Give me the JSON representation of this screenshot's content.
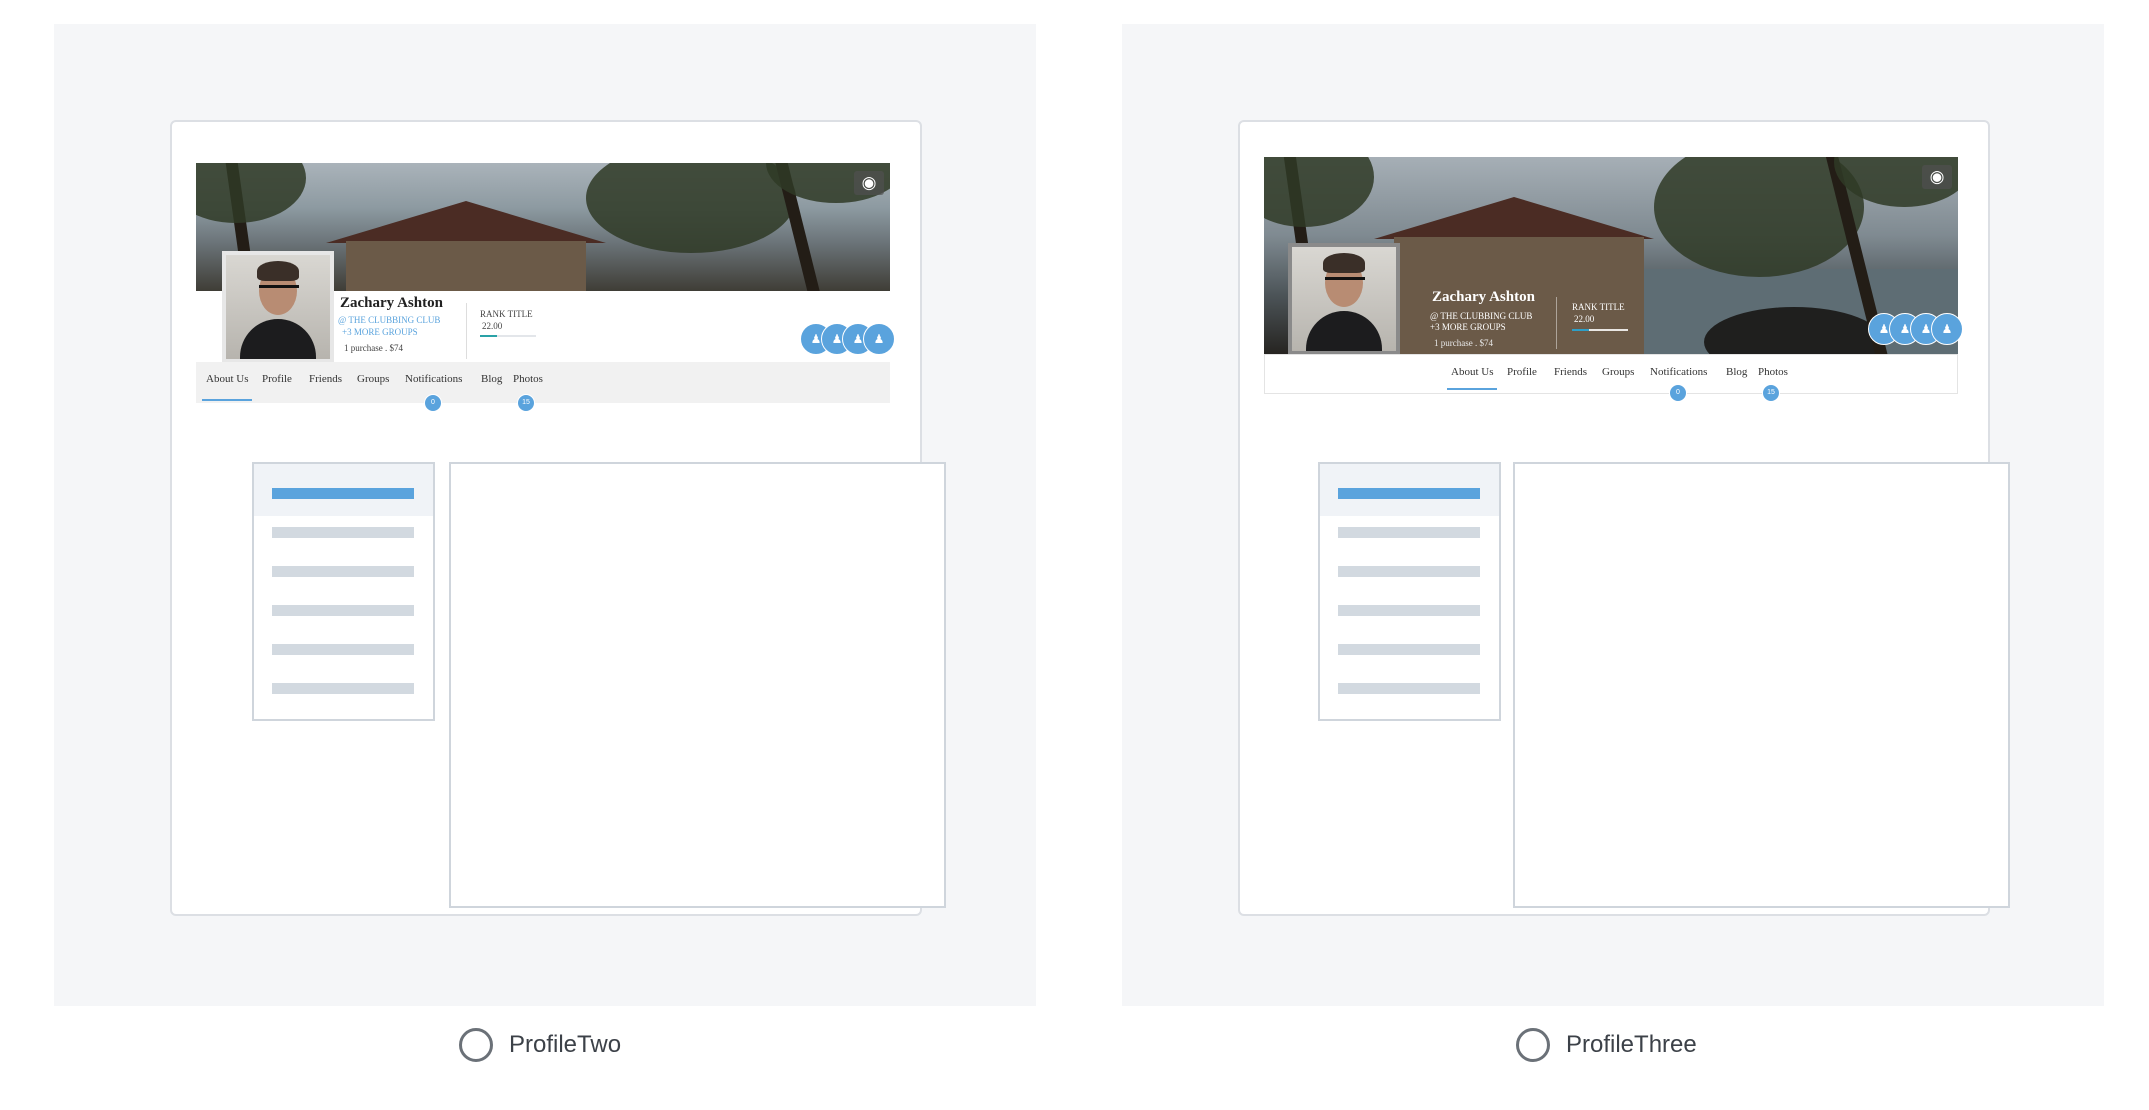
{
  "options": [
    {
      "label": "ProfileTwo",
      "selected": false,
      "profile": {
        "name": "Zachary Ashton",
        "club": "@ THE CLUBBING CLUB",
        "more_groups": "+3 MORE GROUPS",
        "purchase": "1 purchase . $74",
        "rank_title": "RANK TITLE",
        "rank_value": "22.00",
        "rank_progress": 0.3,
        "camera_icon": "camera-icon",
        "group_icons": [
          "group-icon",
          "group-icon",
          "group-icon",
          "group-icon"
        ]
      },
      "tabs": [
        "About Us",
        "Profile",
        "Friends",
        "Groups",
        "Notifications",
        "Blog",
        "Photos"
      ],
      "active_tab": "About Us",
      "counts": {
        "notifications": "0",
        "photos": "15"
      },
      "sidebar_items": 6,
      "active_sidebar_index": 0
    },
    {
      "label": "ProfileThree",
      "selected": false,
      "profile": {
        "name": "Zachary Ashton",
        "club": "@ THE CLUBBING CLUB",
        "more_groups": "+3 MORE GROUPS",
        "purchase": "1 purchase . $74",
        "rank_title": "RANK TITLE",
        "rank_value": "22.00",
        "rank_progress": 0.3,
        "camera_icon": "camera-icon",
        "group_icons": [
          "group-icon",
          "group-icon",
          "group-icon",
          "group-icon"
        ]
      },
      "tabs": [
        "About Us",
        "Profile",
        "Friends",
        "Groups",
        "Notifications",
        "Blog",
        "Photos"
      ],
      "active_tab": "About Us",
      "counts": {
        "notifications": "0",
        "photos": "15"
      },
      "sidebar_items": 6,
      "active_sidebar_index": 0
    }
  ],
  "colors": {
    "accent": "#5aa3dd",
    "panel_bg": "#f5f6f8",
    "border": "#cfd5dc",
    "radio_ring": "#6b7178",
    "rank_fill": "#2aa2a7"
  }
}
